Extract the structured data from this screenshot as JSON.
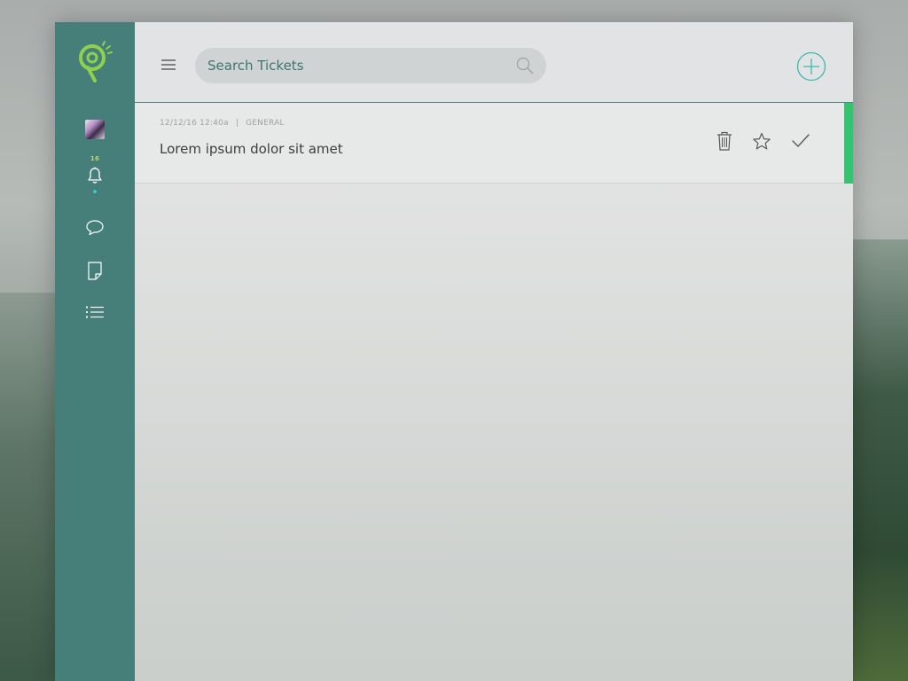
{
  "colors": {
    "sidebar": "#467e7a",
    "accent": "#40b8b0",
    "logo": "#8fd14f",
    "status_open": "#34c470"
  },
  "sidebar": {
    "logo_icon": "quip-logo-icon",
    "avatar_icon": "user-avatar",
    "notifications": {
      "icon": "bell-icon",
      "count": "16"
    },
    "items": [
      {
        "icon": "chat-bubble-icon"
      },
      {
        "icon": "note-icon"
      },
      {
        "icon": "list-icon"
      }
    ]
  },
  "header": {
    "menu_icon": "hamburger-menu-icon",
    "search": {
      "placeholder": "Search Tickets",
      "value": "",
      "icon": "search-icon"
    },
    "add_icon": "plus-circle-icon"
  },
  "tickets": [
    {
      "date": "12/12/16",
      "time": "12:40a",
      "separator": "|",
      "category": "GENERAL",
      "title": "Lorem ipsum dolor sit amet",
      "actions": [
        "trash-icon",
        "star-icon",
        "checkmark-icon"
      ],
      "status_color": "#34c470"
    }
  ]
}
